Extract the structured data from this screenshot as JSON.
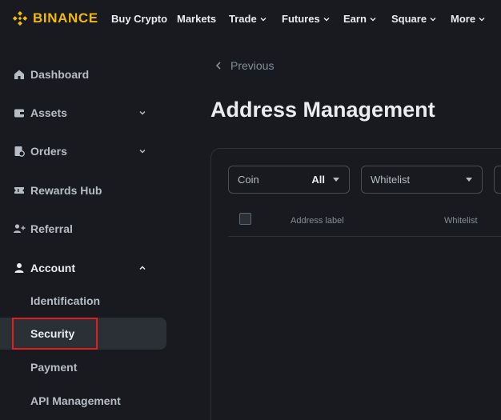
{
  "brand": {
    "name": "BINANCE",
    "color": "#f0b90b"
  },
  "topnav": {
    "items": [
      {
        "label": "Buy Crypto",
        "dropdown": false
      },
      {
        "label": "Markets",
        "dropdown": false
      },
      {
        "label": "Trade",
        "dropdown": true
      },
      {
        "label": "Futures",
        "dropdown": true
      },
      {
        "label": "Earn",
        "dropdown": true
      },
      {
        "label": "Square",
        "dropdown": true
      },
      {
        "label": "More",
        "dropdown": true
      }
    ]
  },
  "sidebar": {
    "items": [
      {
        "label": "Dashboard",
        "icon": "home-icon"
      },
      {
        "label": "Assets",
        "icon": "wallet-icon",
        "expanded": false
      },
      {
        "label": "Orders",
        "icon": "orders-icon",
        "expanded": false
      },
      {
        "label": "Rewards Hub",
        "icon": "ticket-icon"
      },
      {
        "label": "Referral",
        "icon": "add-user-icon"
      },
      {
        "label": "Account",
        "icon": "user-icon",
        "expanded": true
      }
    ],
    "account_sub": [
      {
        "label": "Identification"
      },
      {
        "label": "Security",
        "selected": true
      },
      {
        "label": "Payment"
      },
      {
        "label": "API Management"
      }
    ]
  },
  "main": {
    "back_label": "Previous",
    "title": "Address Management",
    "filters": {
      "coin_label": "Coin",
      "coin_value": "All",
      "whitelist_label": "Whitelist"
    },
    "table": {
      "headers": [
        "Address label",
        "Whitelist"
      ]
    }
  },
  "colors": {
    "background": "#181a20",
    "accent": "#f0b90b",
    "highlight": "#e02020",
    "selected_bg": "#2b2f36"
  }
}
